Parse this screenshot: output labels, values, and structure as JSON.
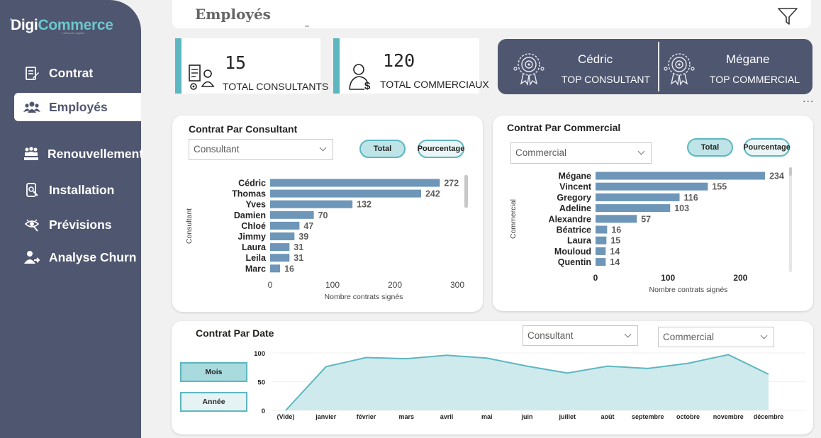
{
  "app": {
    "logo_part1": "Digi",
    "logo_part2": "Commerce",
    "logo_tagline": "L'efficacité digitale"
  },
  "sidebar": {
    "items": [
      {
        "label": "Contrat",
        "icon": "contract-icon",
        "active": false
      },
      {
        "label": "Employés",
        "icon": "people-icon",
        "active": true
      },
      {
        "label": "Renouvellement",
        "icon": "group-icon",
        "active": false
      },
      {
        "label": "Installation",
        "icon": "install-icon",
        "active": false
      },
      {
        "label": "Prévisions",
        "icon": "forecast-icon",
        "active": false
      },
      {
        "label": "Analyse Churn",
        "icon": "churn-icon",
        "active": false
      }
    ]
  },
  "header": {
    "title": "Employés",
    "filter_icon": "filter-icon"
  },
  "kpis": [
    {
      "value": "15",
      "label": "TOTAL CONSULTANTS",
      "icon": "consultant-icon"
    },
    {
      "value": "120",
      "label": "TOTAL COMMERCIAUX",
      "icon": "salesperson-icon"
    }
  ],
  "top": {
    "consultant": {
      "name": "Cédric",
      "role": "TOP CONSULTANT",
      "icon": "award-badge-icon"
    },
    "commercial": {
      "name": "Mégane",
      "role": "TOP COMMERCIAL",
      "icon": "award-badge-icon"
    }
  },
  "more_options": "···",
  "colors": {
    "sidebar": "#4f5670",
    "accent": "#5db7c0",
    "bar": "#6d96b8",
    "area_fill": "#cfeaec",
    "area_line": "#5db7c0"
  },
  "consultant_card": {
    "title": "Contrat Par Consultant",
    "dropdown": "Consultant",
    "btn_total": "Total",
    "btn_percent": "Pourcentage"
  },
  "commercial_card": {
    "title": "Contrat Par Commercial",
    "dropdown": "Commercial",
    "btn_total": "Total",
    "btn_percent": "Pourcentage"
  },
  "date_card": {
    "title": "Contrat Par Date",
    "dropdown_consultant": "Consultant",
    "dropdown_commercial": "Commercial",
    "btn_month": "Mois",
    "btn_year": "Année"
  },
  "chart_data": [
    {
      "type": "bar",
      "orientation": "horizontal",
      "title": "Contrat Par Consultant",
      "ylabel": "Consultant",
      "xlabel": "Nombre contrats signés",
      "categories": [
        "Cédric",
        "Thomas",
        "Yves",
        "Damien",
        "Chloé",
        "Jimmy",
        "Laura",
        "Leila",
        "Marc"
      ],
      "values": [
        272,
        242,
        132,
        70,
        47,
        39,
        31,
        31,
        16
      ],
      "xlim": [
        0,
        300
      ],
      "xticks": [
        "0",
        "100",
        "200",
        "300"
      ]
    },
    {
      "type": "bar",
      "orientation": "horizontal",
      "title": "Contrat Par Commercial",
      "ylabel": "Commercial",
      "xlabel": "Nombre contrats signés",
      "categories": [
        "Mégane",
        "Vincent",
        "Gregory",
        "Adeline",
        "Alexandre",
        "Béatrice",
        "Laura",
        "Mouloud",
        "Quentin"
      ],
      "values": [
        234,
        155,
        116,
        103,
        57,
        16,
        15,
        14,
        14
      ],
      "xlim": [
        0,
        230
      ],
      "xticks": [
        "0",
        "100",
        "200"
      ]
    },
    {
      "type": "area",
      "title": "Contrat Par Date",
      "categories": [
        "(Vide)",
        "janvier",
        "février",
        "mars",
        "avril",
        "mai",
        "juin",
        "juillet",
        "août",
        "septembre",
        "octobre",
        "novembre",
        "décembre"
      ],
      "values": [
        0,
        76,
        92,
        90,
        96,
        91,
        77,
        65,
        77,
        73,
        82,
        97,
        63
      ],
      "ylim": [
        0,
        100
      ],
      "yticks": [
        "0",
        "50",
        "100"
      ]
    }
  ]
}
